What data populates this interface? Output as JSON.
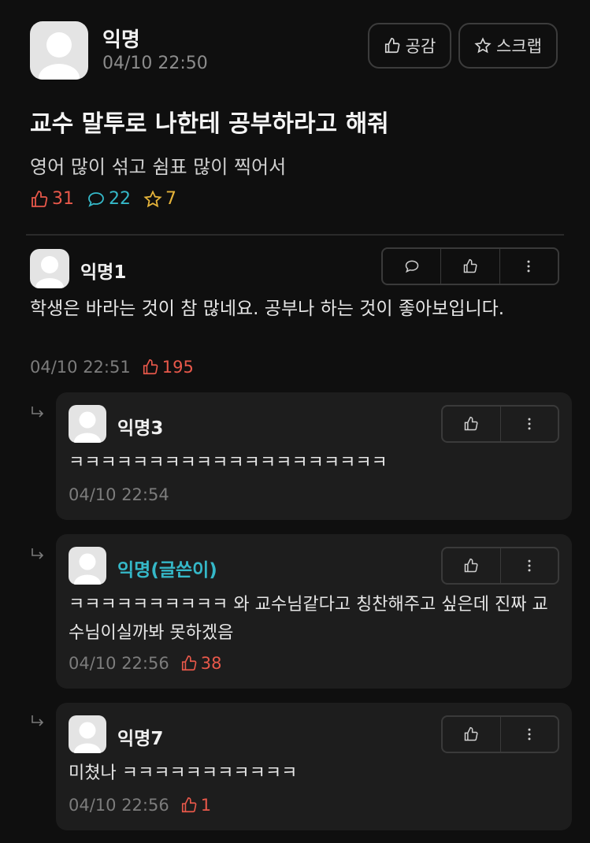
{
  "post": {
    "author": "익명",
    "time": "04/10 22:50",
    "like_button": "공감",
    "scrap_button": "스크랩",
    "title": "교수 말투로 나한테 공부하라고 해줘",
    "body": "영어 많이 섞고 쉼표 많이 찍어서",
    "likes": "31",
    "comments": "22",
    "scraps": "7"
  },
  "comment": {
    "author": "익명1",
    "text": "학생은 바라는 것이 참 많네요. 공부나 하는 것이 좋아보입니다.",
    "time": "04/10 22:51",
    "likes": "195"
  },
  "replies": [
    {
      "author": "익명3",
      "text": "ㅋㅋㅋㅋㅋㅋㅋㅋㅋㅋㅋㅋㅋㅋㅋㅋㅋㅋㅋㅋ",
      "time": "04/10 22:54",
      "likes": ""
    },
    {
      "author": "익명(글쓴이)",
      "text": "ㅋㅋㅋㅋㅋㅋㅋㅋㅋㅋ 와 교수님같다고 칭찬해주고 싶은데 진짜 교수님이실까봐 못하겠음",
      "time": "04/10 22:56",
      "likes": "38"
    },
    {
      "author": "익명7",
      "text": "미쳤나 ㅋㅋㅋㅋㅋㅋㅋㅋㅋㅋㅋ",
      "time": "04/10 22:56",
      "likes": "1"
    }
  ],
  "colors": {
    "accent_red": "#e8584a",
    "accent_cyan": "#35b8c8",
    "accent_gold": "#e6b43a",
    "background": "#0f0f0f"
  },
  "icons": [
    "thumbs-up-icon",
    "star-icon",
    "speech-bubble-icon",
    "more-vertical-icon",
    "reply-arrow-icon",
    "default-avatar-icon"
  ]
}
